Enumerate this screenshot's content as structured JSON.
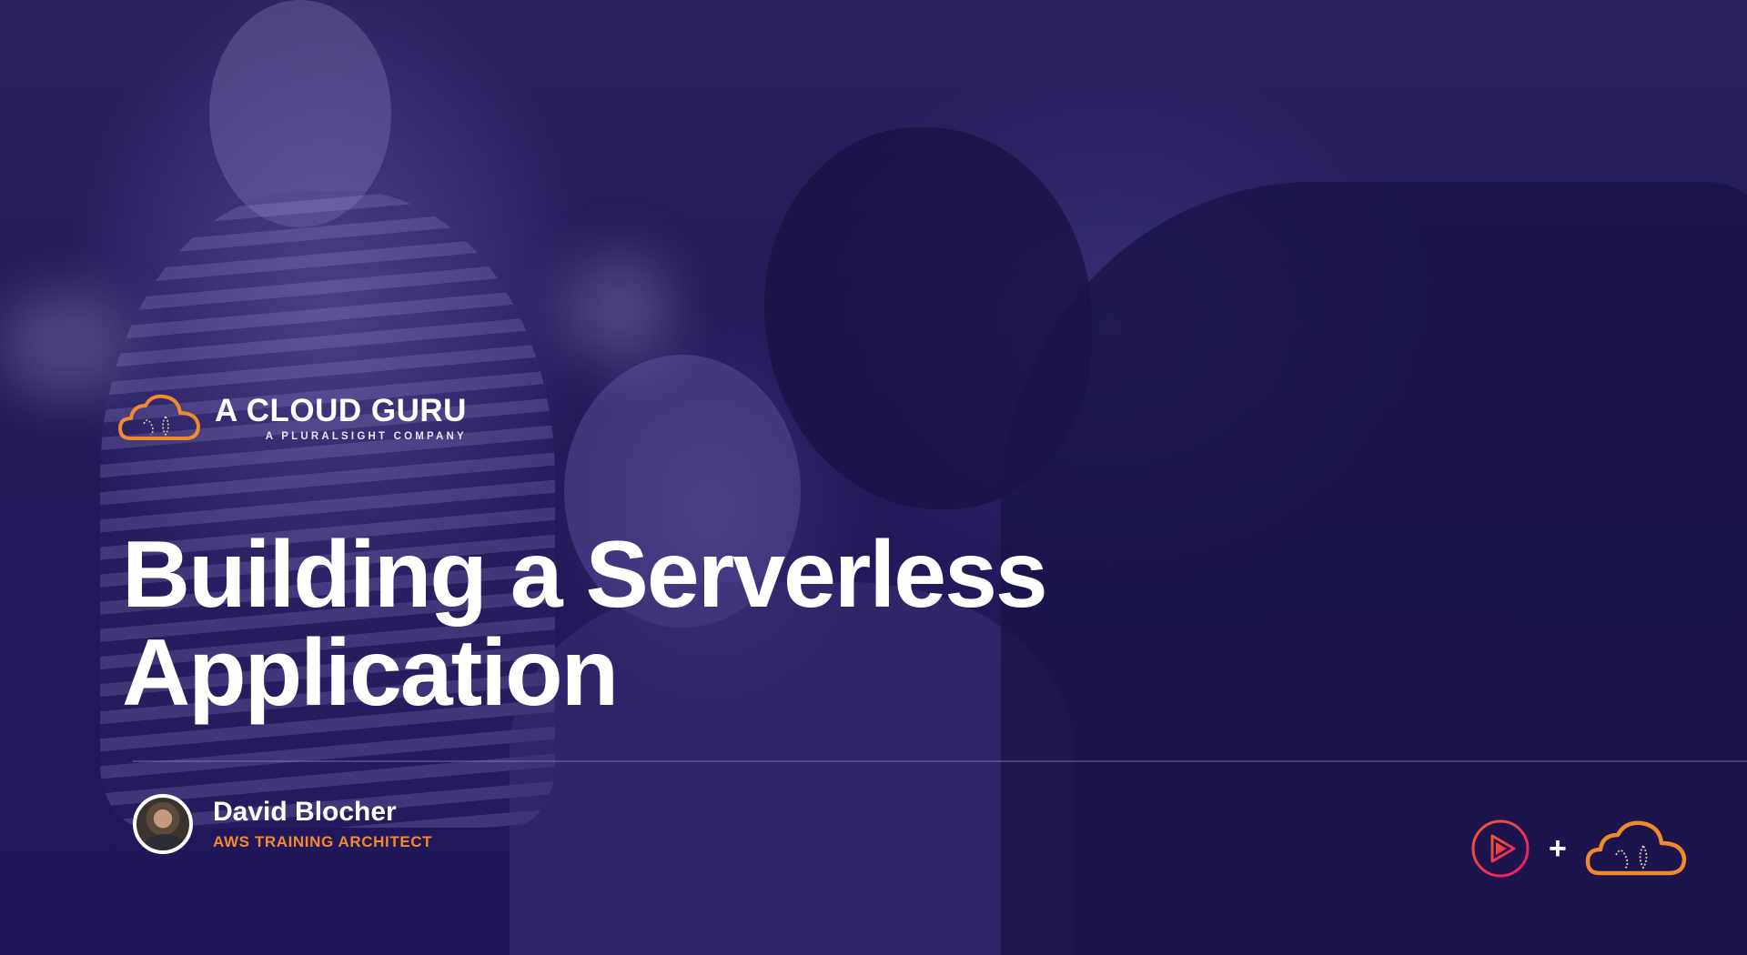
{
  "brand": {
    "name": "A CLOUD GURU",
    "tagline": "A PLURALSIGHT COMPANY",
    "icon": "cloud-logo-icon",
    "accent_color": "#f08a2c"
  },
  "slide": {
    "title_line1": "Building a Serverless",
    "title_line2": "Application"
  },
  "author": {
    "name": "David Blocher",
    "role": "AWS TRAINING ARCHITECT"
  },
  "partners": {
    "pluralsight_icon": "pluralsight-play-icon",
    "plus": "+",
    "acg_icon": "cloud-logo-icon",
    "pluralsight_color": "#e8186d"
  }
}
